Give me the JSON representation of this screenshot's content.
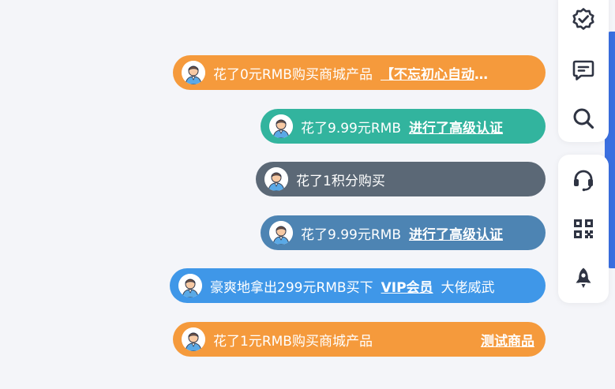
{
  "feed": [
    {
      "message": "花了0元RMB购买商城产品",
      "link": "【不忘初心自动化写作】",
      "tail": "",
      "color": "#f59a3c"
    },
    {
      "message": "花了9.99元RMB",
      "link": "进行了高级认证",
      "tail": "",
      "color": "#32b49e"
    },
    {
      "message": "花了1积分购买",
      "link": "",
      "tail": "",
      "color": "#5b6876"
    },
    {
      "message": "花了9.99元RMB",
      "link": "进行了高级认证",
      "tail": "",
      "color": "#4d84b3"
    },
    {
      "message": "豪爽地拿出299元RMB买下",
      "link": "VIP会员",
      "tail": "大佬威武",
      "color": "#3f97e8"
    },
    {
      "message": "花了1元RMB购买商城产品",
      "link": "测试商品",
      "tail": "",
      "color": "#f59a3c"
    }
  ],
  "toolbar": {
    "accent": "#3a6fe0",
    "buttons": [
      {
        "icon": "verified-badge-icon"
      },
      {
        "icon": "message-icon"
      },
      {
        "icon": "search-icon"
      },
      {
        "icon": "headset-icon"
      },
      {
        "icon": "qr-code-icon"
      },
      {
        "icon": "rocket-icon"
      }
    ]
  }
}
